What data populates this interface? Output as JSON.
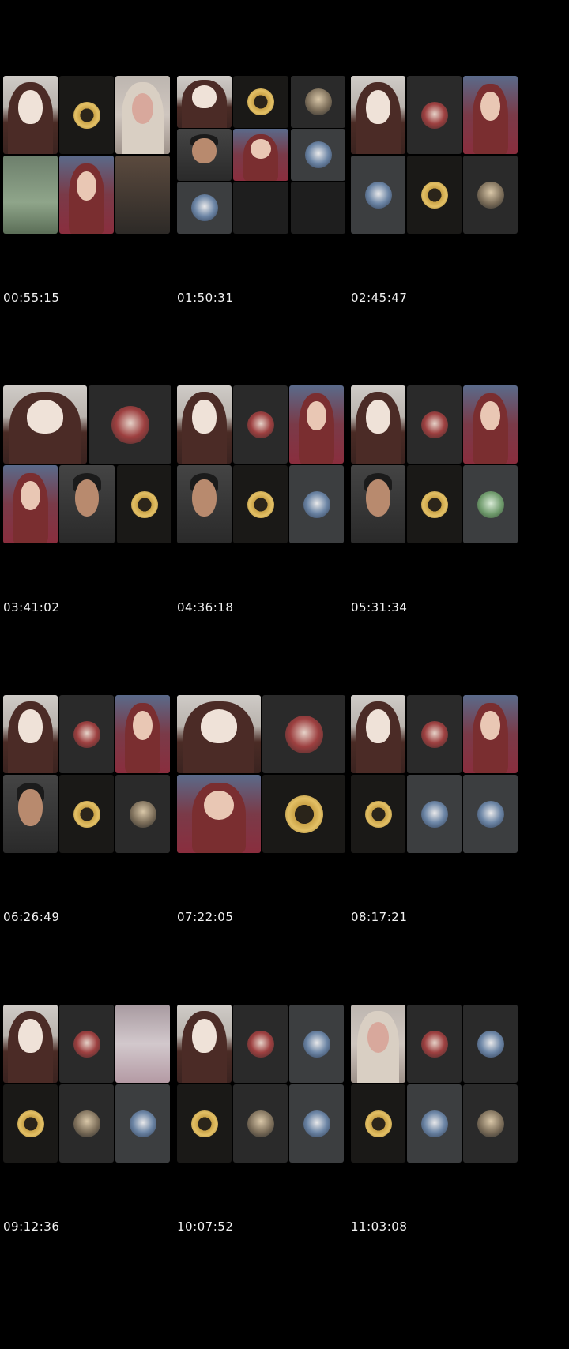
{
  "timestamps": [
    "00:55:15",
    "01:50:31",
    "02:45:47",
    "03:41:02",
    "04:36:18",
    "05:31:34",
    "06:26:49",
    "07:22:05",
    "08:17:21",
    "09:12:36",
    "10:07:52",
    "11:03:08"
  ]
}
